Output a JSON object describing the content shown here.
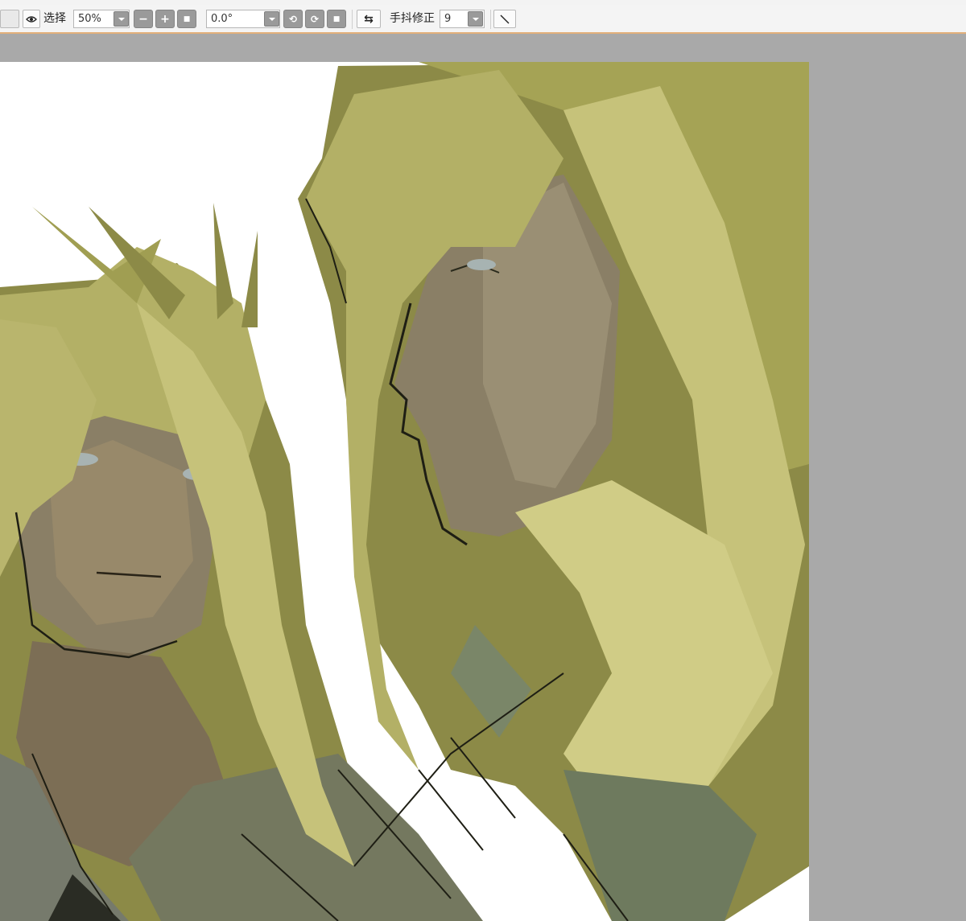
{
  "toolbar": {
    "select_label": "选择",
    "zoom_value": "50%",
    "rotation_value": "0.0°",
    "stabilizer_label": "手抖修正",
    "stabilizer_value": "9"
  },
  "icons": {
    "eye": "eye-icon",
    "zoom_out": "minus-icon",
    "zoom_in": "plus-icon",
    "zoom_reset": "square-icon",
    "rotate_ccw": "rotate-left-icon",
    "rotate_cw": "rotate-right-icon",
    "rotate_reset": "square-icon",
    "flip": "flip-horizontal-icon",
    "line": "line-tool-icon"
  },
  "colors": {
    "toolbar_bg": "#f4f4f4",
    "toolbar_accent": "#e3b07a",
    "canvas_bg": "#a9a9a9",
    "hair": "#c6c27a",
    "hair_shadow": "#6f6d2c",
    "skin": "#8a7f66",
    "shirt": "#7a7e6e"
  }
}
